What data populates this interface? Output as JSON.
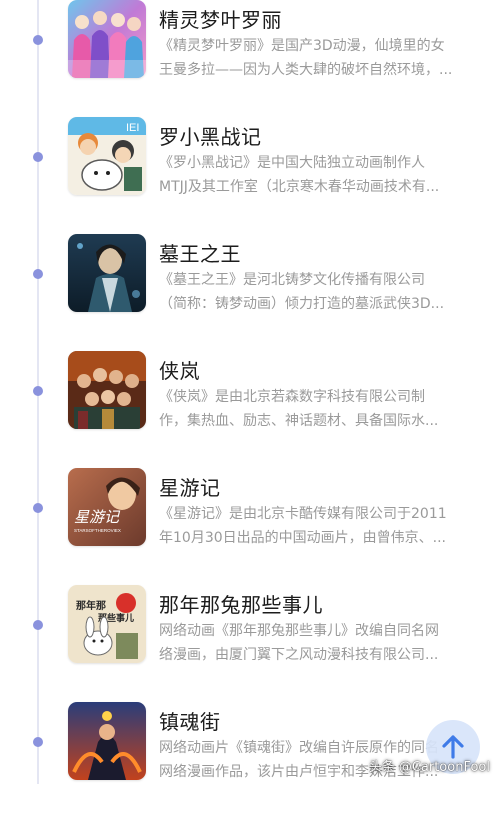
{
  "items": [
    {
      "title": "精灵梦叶罗丽",
      "desc_line1": "《精灵梦叶罗丽》是国产3D动漫，仙境里的女",
      "desc_line2": "王曼多拉——因为人类大肆的破坏自然环境，..."
    },
    {
      "title": "罗小黑战记",
      "desc_line1": "《罗小黑战记》是中国大陆独立动画制作人",
      "desc_line2": "MTJJ及其工作室（北京寒木春华动画技术有..."
    },
    {
      "title": "墓王之王",
      "desc_line1": "《墓王之王》是河北铸梦文化传播有限公司",
      "desc_line2": "（简称：铸梦动画）倾力打造的墓派武侠3D..."
    },
    {
      "title": "侠岚",
      "desc_line1": "《侠岚》是由北京若森数字科技有限公司制",
      "desc_line2": "作，集热血、励志、神话题材、具备国际水..."
    },
    {
      "title": "星游记",
      "desc_line1": "《星游记》是由北京卡酷传媒有限公司于2011",
      "desc_line2": "年10月30日出品的中国动画片，由曾伟京、..."
    },
    {
      "title": "那年那兔那些事儿",
      "desc_line1": "网络动画《那年那兔那些事儿》改编自同名网",
      "desc_line2": "络漫画，由厦门翼下之风动漫科技有限公司..."
    },
    {
      "title": "镇魂街",
      "desc_line1": "网络动画片《镇魂街》改编自许辰原作的同名",
      "desc_line2": "网络漫画作品，该片由卢恒宇和李姝洁工作..."
    }
  ],
  "thumb_texts": {
    "luoxiaohei": "IEI",
    "xingyouji": "星游记",
    "xingyouji_sub": "STARSOFTHEROVIEX",
    "natu_line1": "那年那",
    "natu_line2": "那些事儿"
  },
  "watermark": "头条 @CartoonFool",
  "colors": {
    "timeline_dot": "#8a92dd",
    "timeline_line": "#e4e6f3",
    "scroll_button": "#d7e4fa",
    "scroll_arrow": "#3f7be8"
  },
  "icons": {
    "scroll_top": "arrow-up-icon"
  }
}
